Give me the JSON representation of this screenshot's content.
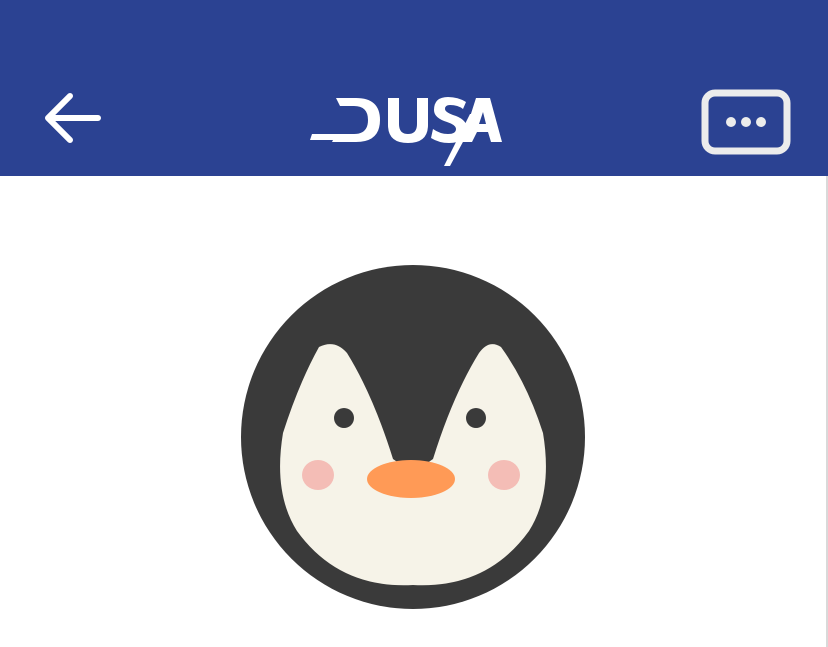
{
  "header": {
    "background_color": "#2b4292",
    "back_button": {
      "icon": "arrow-left-icon"
    },
    "logo": {
      "text": "DUSA"
    },
    "more_button": {
      "icon": "more-horizontal-icon"
    }
  },
  "profile": {
    "avatar": {
      "icon": "penguin-avatar-icon"
    }
  }
}
